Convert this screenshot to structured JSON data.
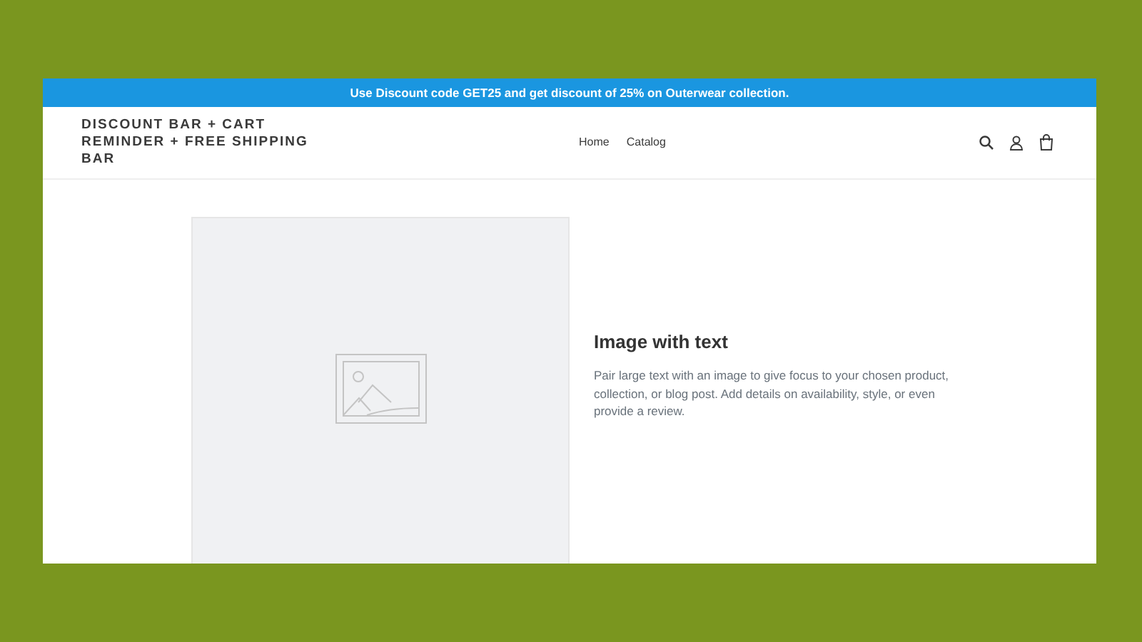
{
  "announcement": "Use Discount code GET25 and get discount of 25% on Outerwear collection.",
  "header": {
    "logo": "DISCOUNT BAR + CART REMINDER + FREE SHIPPING BAR",
    "nav": [
      "Home",
      "Catalog"
    ]
  },
  "feature": {
    "image": {
      "kind": "placeholder"
    },
    "title": "Image with text",
    "body": "Pair large text with an image to give focus to your chosen product, collection, or blog post. Add details on availability, style, or even provide a review."
  }
}
